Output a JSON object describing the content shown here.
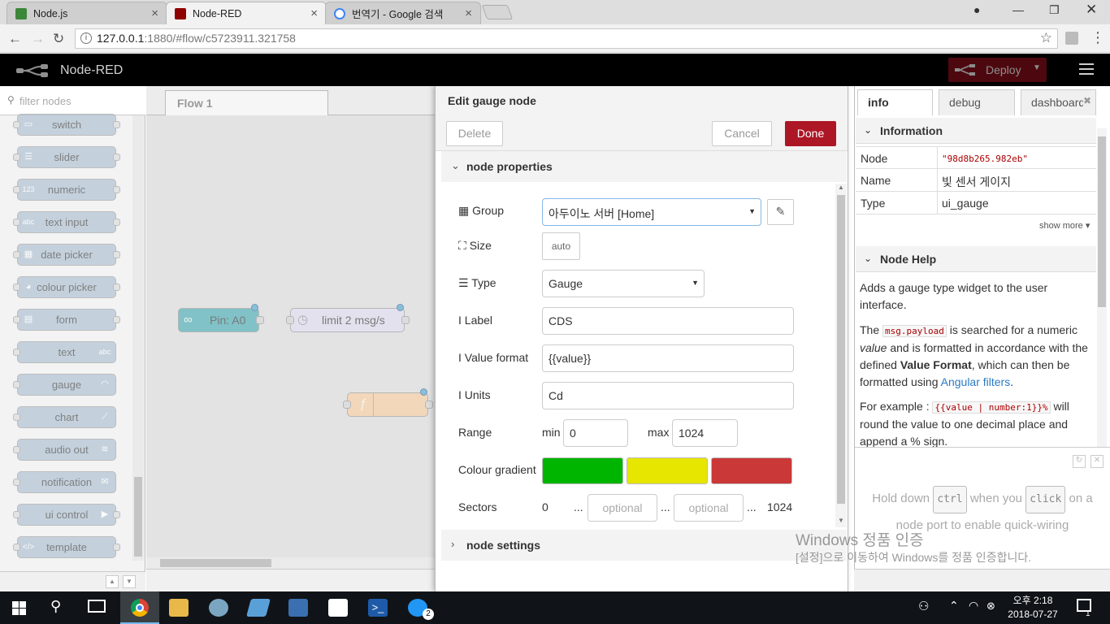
{
  "browser": {
    "tabs": [
      {
        "title": "Node.js",
        "active": false
      },
      {
        "title": "Node-RED",
        "active": true
      },
      {
        "title": "번역기 - Google 검색",
        "active": false
      }
    ],
    "url_host": "127.0.0.1",
    "url_rest": ":1880/#flow/c5723911.321758"
  },
  "header": {
    "app_title": "Node-RED",
    "deploy_label": "Deploy"
  },
  "palette": {
    "filter_placeholder": "filter nodes",
    "nodes": [
      "switch",
      "slider",
      "numeric",
      "text input",
      "date picker",
      "colour picker",
      "form",
      "text",
      "gauge",
      "chart",
      "audio out",
      "notification",
      "ui control",
      "template"
    ]
  },
  "workspace": {
    "tab_label": "Flow 1",
    "nodes": [
      {
        "label": "Pin: A0"
      },
      {
        "label": "limit 2 msg/s"
      }
    ]
  },
  "editor": {
    "title": "Edit gauge node",
    "delete_label": "Delete",
    "cancel_label": "Cancel",
    "done_label": "Done",
    "section_properties": "node properties",
    "section_settings": "node settings",
    "labels": {
      "group": "Group",
      "size": "Size",
      "type": "Type",
      "label": "Label",
      "value_format": "Value format",
      "units": "Units",
      "range": "Range",
      "colour_gradient": "Colour gradient",
      "sectors": "Sectors"
    },
    "group_value": "아두이노 서버 [Home]",
    "size_value": "auto",
    "type_value": "Gauge",
    "label_value": "CDS",
    "value_format_value": "{{value}}",
    "units_value": "Cd",
    "range": {
      "min_label": "min",
      "min_value": "0",
      "max_label": "max",
      "max_value": "1024"
    },
    "gradient_colors": [
      "#00b500",
      "#e6e600",
      "#ca3838"
    ],
    "sectors": {
      "start": "0",
      "dots": "...",
      "placeholder": "optional",
      "end": "1024"
    }
  },
  "sidebar": {
    "tabs": [
      "info",
      "debug",
      "dashboard"
    ],
    "info_heading": "Information",
    "rows": [
      {
        "key": "Node",
        "value": "\"98d8b265.982eb\""
      },
      {
        "key": "Name",
        "value": "빛 센서 게이지"
      },
      {
        "key": "Type",
        "value": "ui_gauge"
      }
    ],
    "show_more": "show more ▾",
    "help_heading": "Node Help",
    "help_p1": "Adds a gauge type widget to the user interface.",
    "help_p2_a": "The",
    "help_p2_code": "msg.payload",
    "help_p2_b": "is searched for a numeric",
    "help_p2_value": "value",
    "help_p2_c": "and is formatted in accordance with the defined",
    "help_p2_strong": "Value Format",
    "help_p2_d": ", which can then be formatted using",
    "help_p2_link": "Angular filters",
    "help_p3_a": "For example :",
    "help_p3_code": "{{value | number:1}}%",
    "help_p3_b": "will round the value to one decimal place and append a % sign.",
    "tip_a": "Hold down",
    "tip_key1": "ctrl",
    "tip_b": "when you",
    "tip_key2": "click",
    "tip_c": "on a node port to enable quick-wiring"
  },
  "watermark": {
    "line1": "Windows 정품 인증",
    "line2": "[설정]으로 이동하여 Windows를 정품 인증합니다."
  },
  "taskbar": {
    "time": "오후 2:18",
    "date": "2018-07-27",
    "badge": "2",
    "notif_count": "1"
  }
}
